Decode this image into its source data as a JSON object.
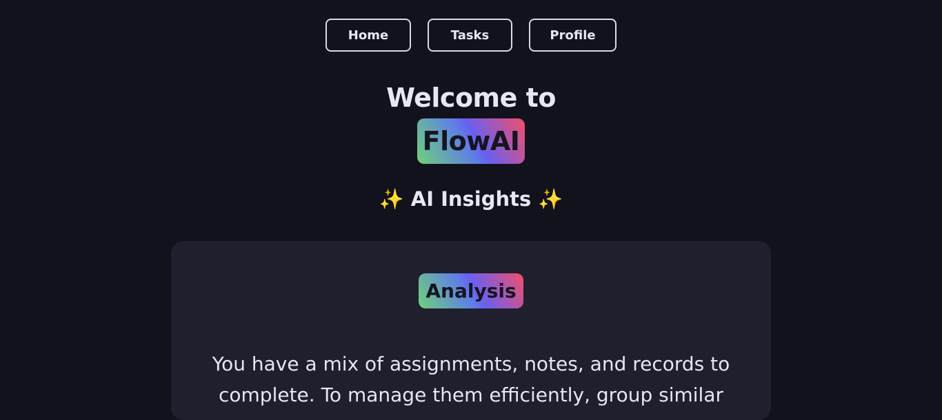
{
  "nav": {
    "home_label": "Home",
    "tasks_label": "Tasks",
    "profile_label": "Profile"
  },
  "hero": {
    "welcome": "Welcome to",
    "brand": "FlowAI"
  },
  "insights": {
    "sparkle_left": "✨",
    "title": "AI Insights",
    "sparkle_right": "✨"
  },
  "card": {
    "badge": "Analysis",
    "text": "You have a mix of assignments, notes, and records to complete. To manage them efficiently, group similar"
  },
  "colors": {
    "background": "#12121c",
    "card": "#1f1f2e",
    "gradient_start": "#6fd27a",
    "gradient_mid": "#6a5ff0",
    "gradient_end": "#f24f6a",
    "sparkle": "#f6c94a"
  }
}
